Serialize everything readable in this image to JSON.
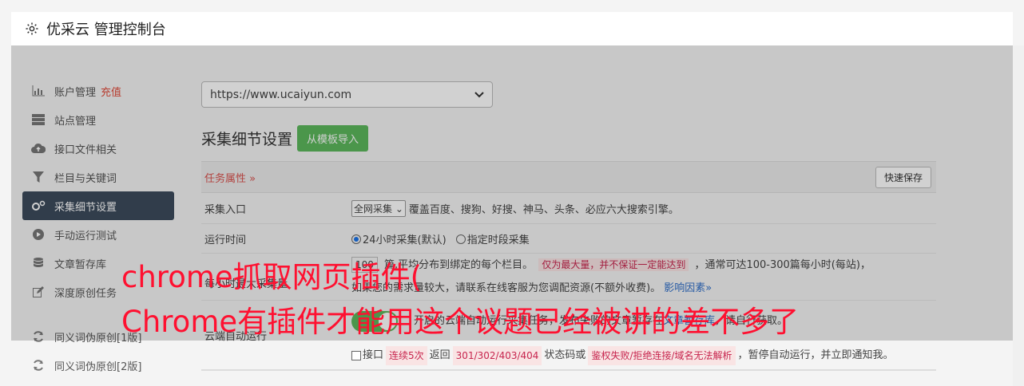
{
  "header": {
    "title": "优采云 管理控制台",
    "icon": "gear-icon"
  },
  "sidebar": {
    "items": [
      {
        "label": "账户管理",
        "extra": "充值",
        "icon": "bar-chart-icon"
      },
      {
        "label": "站点管理",
        "icon": "server-icon"
      },
      {
        "label": "接口文件相关",
        "icon": "cloud-upload-icon"
      },
      {
        "label": "栏目与关键词",
        "icon": "filter-icon"
      },
      {
        "label": "采集细节设置",
        "icon": "gears-icon",
        "active": true
      },
      {
        "label": "手动运行测试",
        "icon": "play-icon"
      },
      {
        "label": "文章暂存库",
        "icon": "database-icon"
      },
      {
        "label": "深度原创任务",
        "icon": "edit-icon"
      },
      {
        "label": "同义词伪原创[1版]",
        "icon": "refresh-icon"
      },
      {
        "label": "同义词伪原创[2版]",
        "icon": "refresh-icon"
      }
    ]
  },
  "main": {
    "site_select": "https://www.ucaiyun.com",
    "section_title": "采集细节设置",
    "import_button": "从模板导入",
    "panel_tab": "任务属性 »",
    "save_button": "快速保存",
    "rows": {
      "entry": {
        "label": "采集入口",
        "select": "全网采集",
        "desc": "覆盖百度、搜狗、好搜、神马、头条、必应六大搜索引擎。"
      },
      "time": {
        "label": "运行时间",
        "opt1": "24小时采集(默认)",
        "opt2": "指定时段采集"
      },
      "max": {
        "label": "每小时最大采集量",
        "value": "100",
        "text1": "篇,平均分布到绑定的每个栏目。",
        "tag": "仅为最大量，并不保证一定能达到",
        "text2": "，通常可达100-300篇每小时(每站)，",
        "text3": "如果您的需求量较大，请联系在线客服为您调配资源(不额外收费)。",
        "link": "影响因素»"
      },
      "cloud": {
        "label": "云端自动运行",
        "text1": "开启的云端自动运行采集任务，发布失败的文章暂存在",
        "link": "文章暂存库",
        "text2": "，请自行获取。",
        "check_label": "接口",
        "tag1": "连续5次",
        "text3": "返回",
        "tag2": "301/302/403/404",
        "text4": "状态码或",
        "tag3": "鉴权失败/拒绝连接/域名无法解析",
        "text5": "，暂停自动运行，并立即通知我。"
      }
    }
  },
  "watermark": {
    "line1": "chrome抓取网页插件(",
    "line2": "Chrome有插件才能用这个议题已经被讲的差不多了"
  }
}
